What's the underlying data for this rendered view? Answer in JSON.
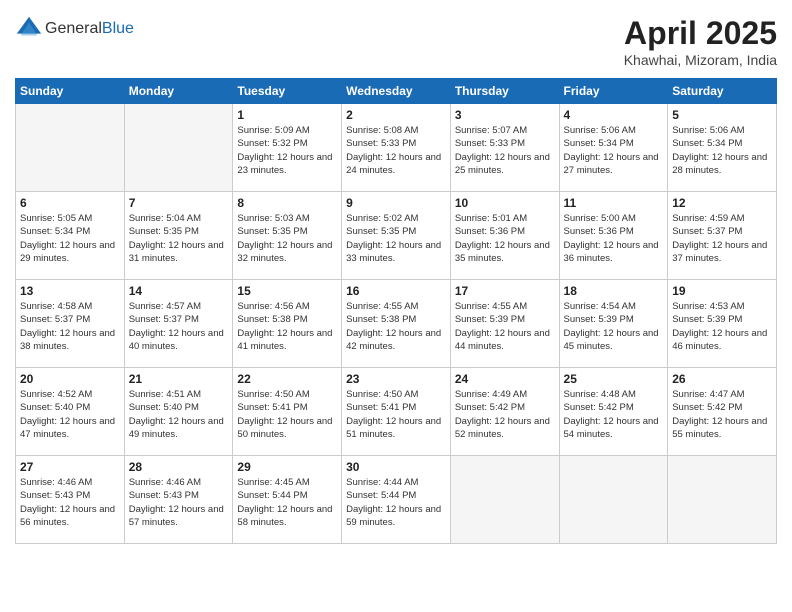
{
  "logo": {
    "general": "General",
    "blue": "Blue"
  },
  "title": {
    "month_year": "April 2025",
    "location": "Khawhai, Mizoram, India"
  },
  "days_of_week": [
    "Sunday",
    "Monday",
    "Tuesday",
    "Wednesday",
    "Thursday",
    "Friday",
    "Saturday"
  ],
  "weeks": [
    [
      {
        "day": "",
        "sunrise": "",
        "sunset": "",
        "daylight": ""
      },
      {
        "day": "",
        "sunrise": "",
        "sunset": "",
        "daylight": ""
      },
      {
        "day": "1",
        "sunrise": "Sunrise: 5:09 AM",
        "sunset": "Sunset: 5:32 PM",
        "daylight": "Daylight: 12 hours and 23 minutes."
      },
      {
        "day": "2",
        "sunrise": "Sunrise: 5:08 AM",
        "sunset": "Sunset: 5:33 PM",
        "daylight": "Daylight: 12 hours and 24 minutes."
      },
      {
        "day": "3",
        "sunrise": "Sunrise: 5:07 AM",
        "sunset": "Sunset: 5:33 PM",
        "daylight": "Daylight: 12 hours and 25 minutes."
      },
      {
        "day": "4",
        "sunrise": "Sunrise: 5:06 AM",
        "sunset": "Sunset: 5:34 PM",
        "daylight": "Daylight: 12 hours and 27 minutes."
      },
      {
        "day": "5",
        "sunrise": "Sunrise: 5:06 AM",
        "sunset": "Sunset: 5:34 PM",
        "daylight": "Daylight: 12 hours and 28 minutes."
      }
    ],
    [
      {
        "day": "6",
        "sunrise": "Sunrise: 5:05 AM",
        "sunset": "Sunset: 5:34 PM",
        "daylight": "Daylight: 12 hours and 29 minutes."
      },
      {
        "day": "7",
        "sunrise": "Sunrise: 5:04 AM",
        "sunset": "Sunset: 5:35 PM",
        "daylight": "Daylight: 12 hours and 31 minutes."
      },
      {
        "day": "8",
        "sunrise": "Sunrise: 5:03 AM",
        "sunset": "Sunset: 5:35 PM",
        "daylight": "Daylight: 12 hours and 32 minutes."
      },
      {
        "day": "9",
        "sunrise": "Sunrise: 5:02 AM",
        "sunset": "Sunset: 5:35 PM",
        "daylight": "Daylight: 12 hours and 33 minutes."
      },
      {
        "day": "10",
        "sunrise": "Sunrise: 5:01 AM",
        "sunset": "Sunset: 5:36 PM",
        "daylight": "Daylight: 12 hours and 35 minutes."
      },
      {
        "day": "11",
        "sunrise": "Sunrise: 5:00 AM",
        "sunset": "Sunset: 5:36 PM",
        "daylight": "Daylight: 12 hours and 36 minutes."
      },
      {
        "day": "12",
        "sunrise": "Sunrise: 4:59 AM",
        "sunset": "Sunset: 5:37 PM",
        "daylight": "Daylight: 12 hours and 37 minutes."
      }
    ],
    [
      {
        "day": "13",
        "sunrise": "Sunrise: 4:58 AM",
        "sunset": "Sunset: 5:37 PM",
        "daylight": "Daylight: 12 hours and 38 minutes."
      },
      {
        "day": "14",
        "sunrise": "Sunrise: 4:57 AM",
        "sunset": "Sunset: 5:37 PM",
        "daylight": "Daylight: 12 hours and 40 minutes."
      },
      {
        "day": "15",
        "sunrise": "Sunrise: 4:56 AM",
        "sunset": "Sunset: 5:38 PM",
        "daylight": "Daylight: 12 hours and 41 minutes."
      },
      {
        "day": "16",
        "sunrise": "Sunrise: 4:55 AM",
        "sunset": "Sunset: 5:38 PM",
        "daylight": "Daylight: 12 hours and 42 minutes."
      },
      {
        "day": "17",
        "sunrise": "Sunrise: 4:55 AM",
        "sunset": "Sunset: 5:39 PM",
        "daylight": "Daylight: 12 hours and 44 minutes."
      },
      {
        "day": "18",
        "sunrise": "Sunrise: 4:54 AM",
        "sunset": "Sunset: 5:39 PM",
        "daylight": "Daylight: 12 hours and 45 minutes."
      },
      {
        "day": "19",
        "sunrise": "Sunrise: 4:53 AM",
        "sunset": "Sunset: 5:39 PM",
        "daylight": "Daylight: 12 hours and 46 minutes."
      }
    ],
    [
      {
        "day": "20",
        "sunrise": "Sunrise: 4:52 AM",
        "sunset": "Sunset: 5:40 PM",
        "daylight": "Daylight: 12 hours and 47 minutes."
      },
      {
        "day": "21",
        "sunrise": "Sunrise: 4:51 AM",
        "sunset": "Sunset: 5:40 PM",
        "daylight": "Daylight: 12 hours and 49 minutes."
      },
      {
        "day": "22",
        "sunrise": "Sunrise: 4:50 AM",
        "sunset": "Sunset: 5:41 PM",
        "daylight": "Daylight: 12 hours and 50 minutes."
      },
      {
        "day": "23",
        "sunrise": "Sunrise: 4:50 AM",
        "sunset": "Sunset: 5:41 PM",
        "daylight": "Daylight: 12 hours and 51 minutes."
      },
      {
        "day": "24",
        "sunrise": "Sunrise: 4:49 AM",
        "sunset": "Sunset: 5:42 PM",
        "daylight": "Daylight: 12 hours and 52 minutes."
      },
      {
        "day": "25",
        "sunrise": "Sunrise: 4:48 AM",
        "sunset": "Sunset: 5:42 PM",
        "daylight": "Daylight: 12 hours and 54 minutes."
      },
      {
        "day": "26",
        "sunrise": "Sunrise: 4:47 AM",
        "sunset": "Sunset: 5:42 PM",
        "daylight": "Daylight: 12 hours and 55 minutes."
      }
    ],
    [
      {
        "day": "27",
        "sunrise": "Sunrise: 4:46 AM",
        "sunset": "Sunset: 5:43 PM",
        "daylight": "Daylight: 12 hours and 56 minutes."
      },
      {
        "day": "28",
        "sunrise": "Sunrise: 4:46 AM",
        "sunset": "Sunset: 5:43 PM",
        "daylight": "Daylight: 12 hours and 57 minutes."
      },
      {
        "day": "29",
        "sunrise": "Sunrise: 4:45 AM",
        "sunset": "Sunset: 5:44 PM",
        "daylight": "Daylight: 12 hours and 58 minutes."
      },
      {
        "day": "30",
        "sunrise": "Sunrise: 4:44 AM",
        "sunset": "Sunset: 5:44 PM",
        "daylight": "Daylight: 12 hours and 59 minutes."
      },
      {
        "day": "",
        "sunrise": "",
        "sunset": "",
        "daylight": ""
      },
      {
        "day": "",
        "sunrise": "",
        "sunset": "",
        "daylight": ""
      },
      {
        "day": "",
        "sunrise": "",
        "sunset": "",
        "daylight": ""
      }
    ]
  ]
}
